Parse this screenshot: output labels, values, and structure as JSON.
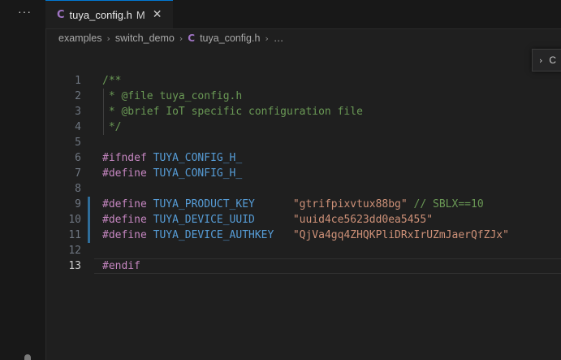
{
  "sidebar": {
    "more_label": "···"
  },
  "tab": {
    "icon": "C",
    "label": "tuya_config.h",
    "modified": "M",
    "close": "✕"
  },
  "breadcrumb": {
    "items": [
      "examples",
      "switch_demo"
    ],
    "file_icon": "C",
    "file": "tuya_config.h",
    "tail": "…"
  },
  "sticky_widget": {
    "chevron": "›",
    "text": "C"
  },
  "editor": {
    "lines": [
      {
        "n": "1",
        "tokens": [
          [
            "comment",
            "/**"
          ]
        ]
      },
      {
        "n": "2",
        "tokens": [
          [
            "comment",
            " * @file tuya_config.h"
          ]
        ]
      },
      {
        "n": "3",
        "tokens": [
          [
            "comment",
            " * @brief IoT specific configuration file"
          ]
        ]
      },
      {
        "n": "4",
        "tokens": [
          [
            "comment",
            " */"
          ]
        ]
      },
      {
        "n": "5",
        "tokens": []
      },
      {
        "n": "6",
        "tokens": [
          [
            "pre",
            "#ifndef"
          ],
          [
            "plain",
            " "
          ],
          [
            "macro",
            "TUYA_CONFIG_H_"
          ]
        ]
      },
      {
        "n": "7",
        "tokens": [
          [
            "pre",
            "#define"
          ],
          [
            "plain",
            " "
          ],
          [
            "macro",
            "TUYA_CONFIG_H_"
          ]
        ]
      },
      {
        "n": "8",
        "tokens": []
      },
      {
        "n": "9",
        "tokens": [
          [
            "pre",
            "#define"
          ],
          [
            "plain",
            " "
          ],
          [
            "macro",
            "TUYA_PRODUCT_KEY"
          ],
          [
            "plain",
            "      "
          ],
          [
            "str",
            "\"gtrifpixvtux88bg\""
          ],
          [
            "plain",
            " "
          ],
          [
            "comment",
            "// SBLX==10"
          ]
        ]
      },
      {
        "n": "10",
        "tokens": [
          [
            "pre",
            "#define"
          ],
          [
            "plain",
            " "
          ],
          [
            "macro",
            "TUYA_DEVICE_UUID"
          ],
          [
            "plain",
            "      "
          ],
          [
            "str",
            "\"uuid4ce5623dd0ea5455\""
          ]
        ]
      },
      {
        "n": "11",
        "tokens": [
          [
            "pre",
            "#define"
          ],
          [
            "plain",
            " "
          ],
          [
            "macro",
            "TUYA_DEVICE_AUTHKEY"
          ],
          [
            "plain",
            "   "
          ],
          [
            "str",
            "\"QjVa4gq4ZHQKPliDRxIrUZmJaerQfZJx\""
          ]
        ]
      },
      {
        "n": "12",
        "tokens": []
      },
      {
        "n": "13",
        "tokens": [
          [
            "pre",
            "#endif"
          ]
        ]
      }
    ],
    "active_line": "13",
    "modified_lines": [
      "9",
      "10",
      "11"
    ]
  }
}
